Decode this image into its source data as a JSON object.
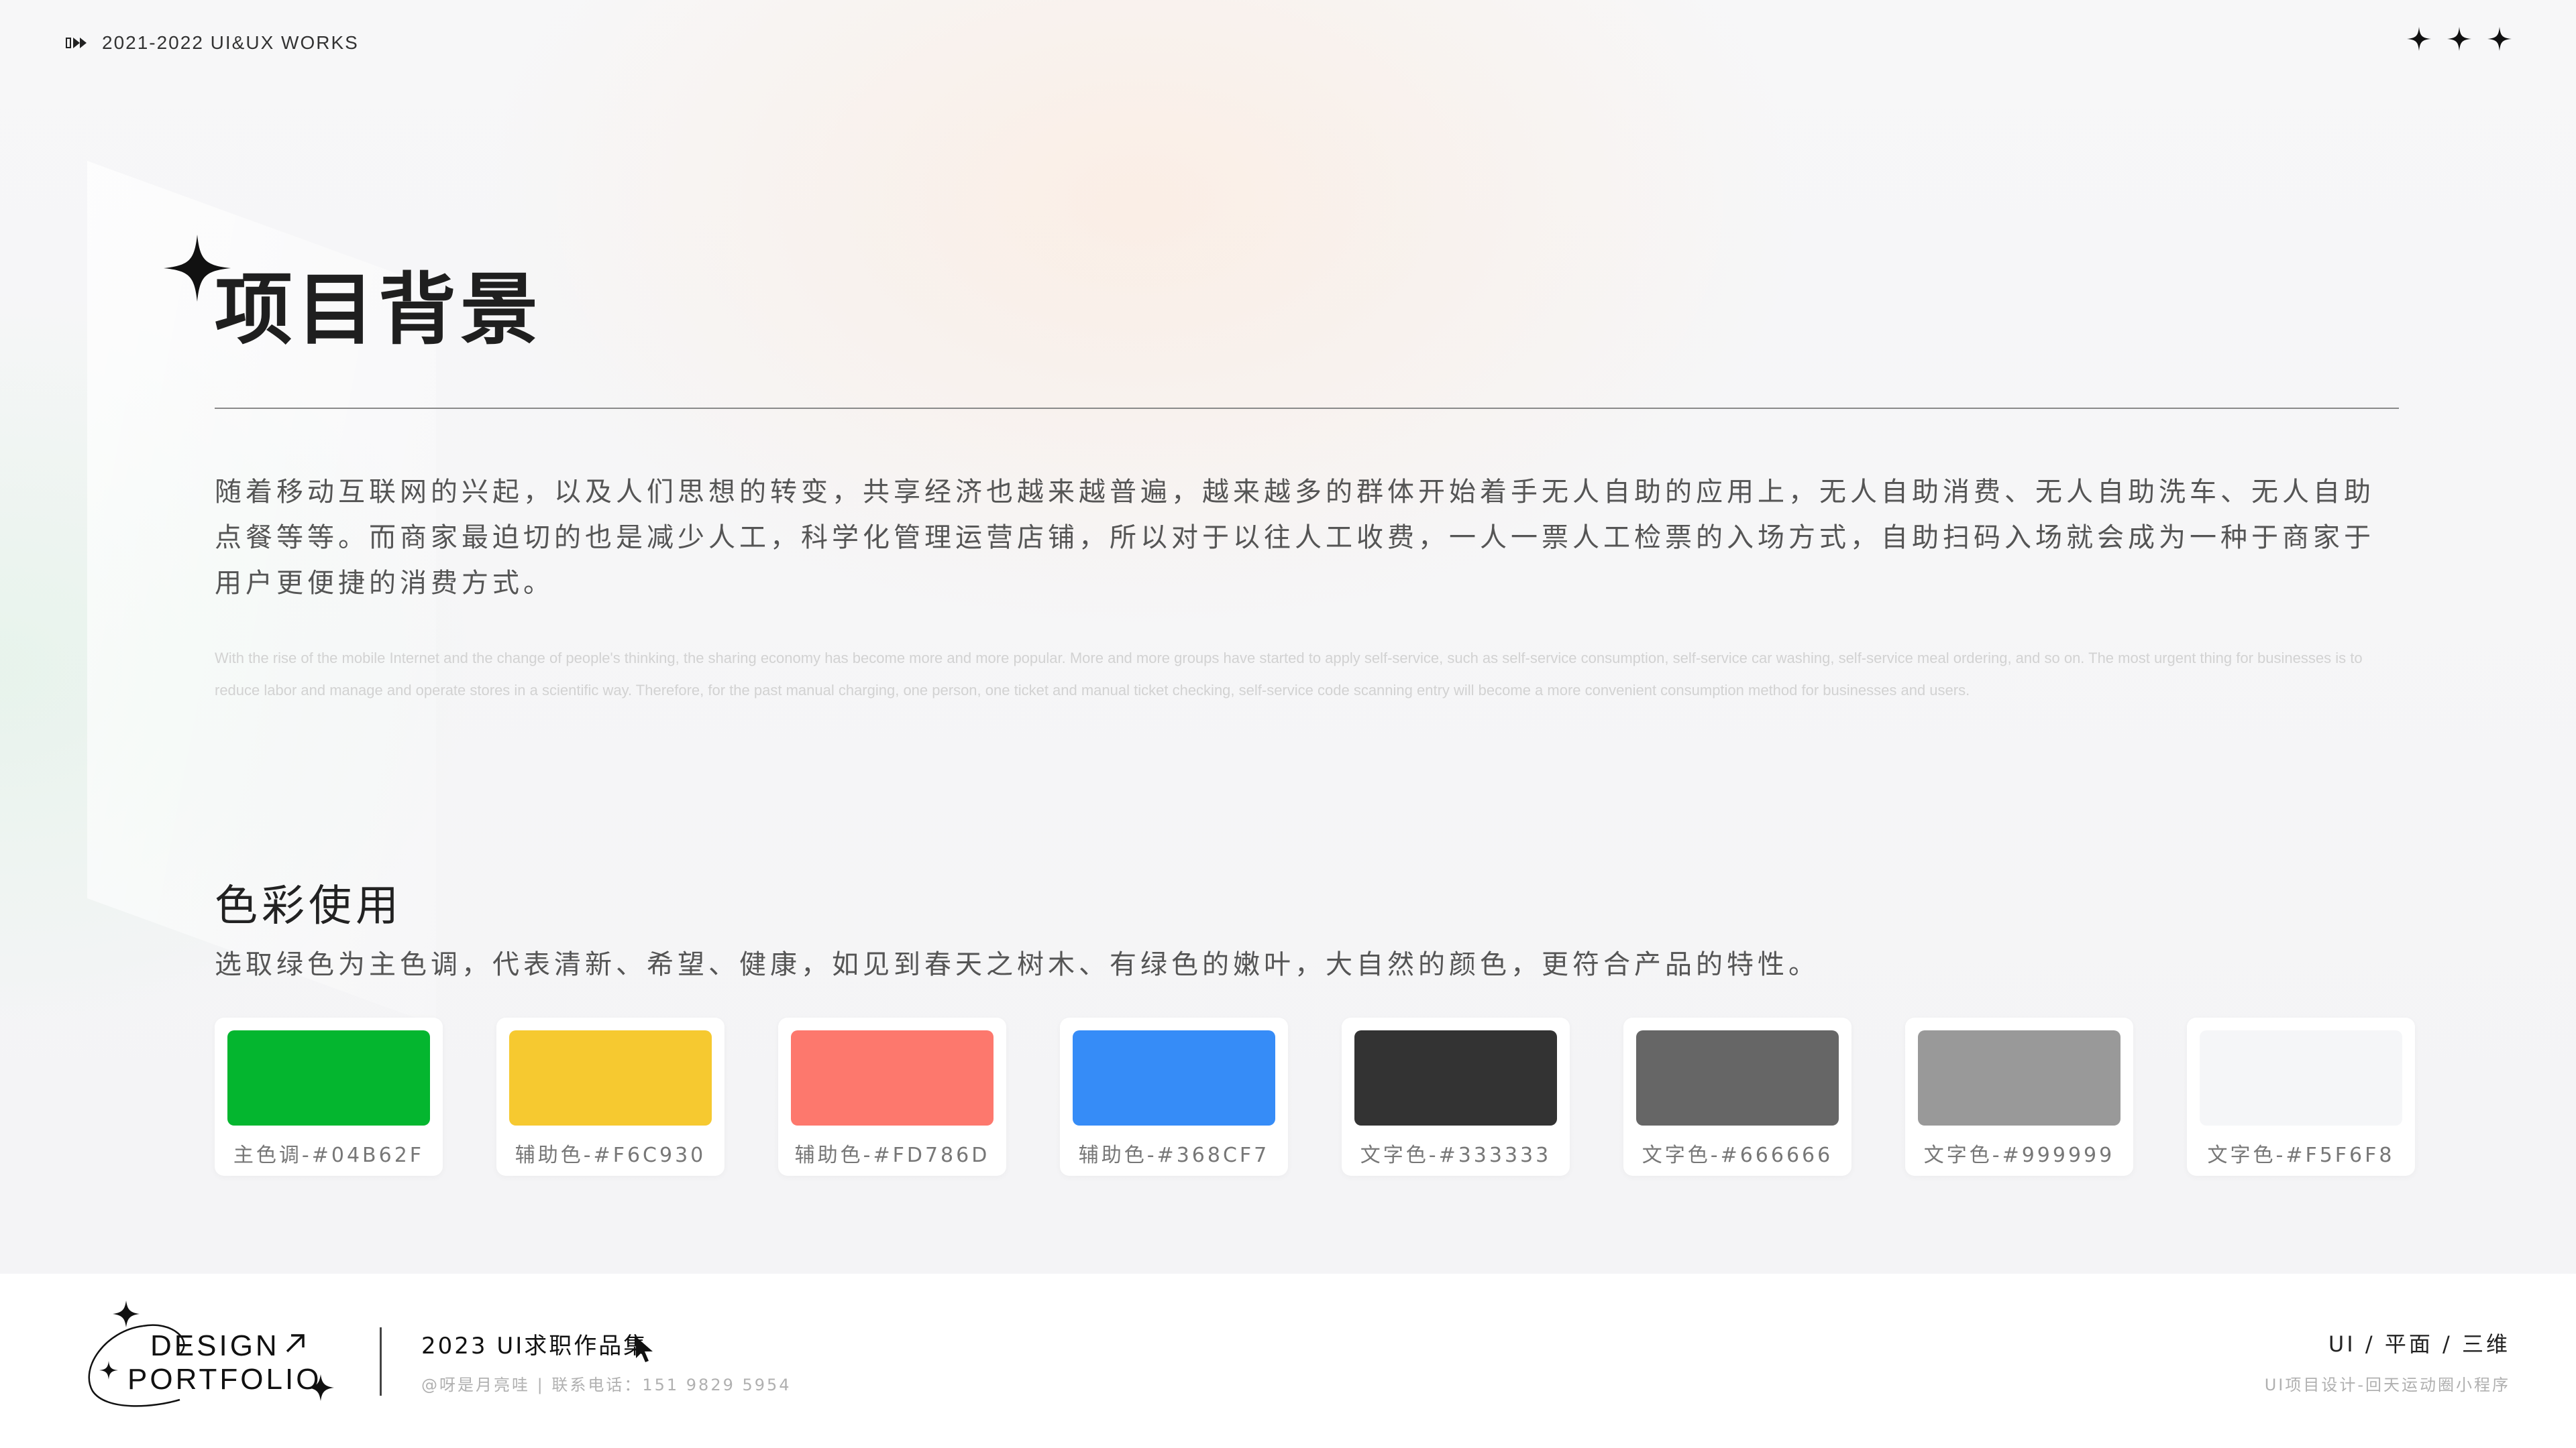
{
  "topbar": {
    "icon": "fast-forward-icon",
    "label": "2021-2022 UI&UX WORKS",
    "stars": [
      "sparkle-icon",
      "sparkle-icon",
      "sparkle-icon"
    ]
  },
  "header": {
    "title": "项目背景",
    "title_icon": "sparkle-icon"
  },
  "intro": {
    "cn": "随着移动互联网的兴起，以及人们思想的转变，共享经济也越来越普遍，越来越多的群体开始着手无人自助的应用上，无人自助消费、无人自助洗车、无人自助点餐等等。而商家最迫切的也是减少人工，科学化管理运营店铺，所以对于以往人工收费，一人一票人工检票的入场方式，自助扫码入场就会成为一种于商家于用户更便捷的消费方式。",
    "en": "With the rise of the mobile Internet and the change of people's thinking, the sharing economy has become more and more popular. More and more groups have started to apply self-service, such as self-service consumption, self-service car washing, self-service meal ordering, and so on. The most urgent thing for businesses is to reduce labor and manage and operate stores in a scientific way. Therefore, for the past manual charging, one person, one ticket and manual ticket checking, self-service code scanning entry will become a more convenient consumption method for businesses and users."
  },
  "colors_section": {
    "title": "色彩使用",
    "description": "选取绿色为主色调，代表清新、希望、健康，如见到春天之树木、有绿色的嫩叶，大自然的颜色，更符合产品的特性。",
    "swatches": [
      {
        "label": "主色调-#04B62F",
        "color": "#04B62F"
      },
      {
        "label": "辅助色-#F6C930",
        "color": "#F6C930"
      },
      {
        "label": "辅助色-#FD786D",
        "color": "#FD786D"
      },
      {
        "label": "辅助色-#368CF7",
        "color": "#368CF7"
      },
      {
        "label": "文字色-#333333",
        "color": "#333333"
      },
      {
        "label": "文字色-#666666",
        "color": "#666666"
      },
      {
        "label": "文字色-#999999",
        "color": "#999999"
      },
      {
        "label": "文字色-#F5F6F8",
        "color": "#F5F6F8"
      }
    ]
  },
  "footer": {
    "logo_line1": "DESIGN",
    "logo_line2": "PORTFOLIO",
    "logo_arrow": "arrow-up-right-icon",
    "title": "2023 UI求职作品集",
    "cursor": "cursor-icon",
    "contact": "@呀是月亮哇 | 联系电话：151 9829 5954",
    "tags": "UI / 平面 / 三维",
    "project": "UI项目设计-回天运动圈小程序"
  }
}
